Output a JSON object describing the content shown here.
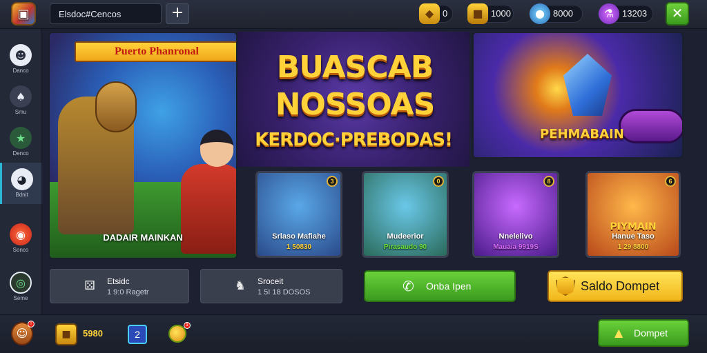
{
  "colors": {
    "accent_green": "#4caf28",
    "accent_yellow": "#ffd23a",
    "background": "#1c2030"
  },
  "header": {
    "search_value": "Elsdoc#Cencos",
    "add_label": "+",
    "close_label": "✕",
    "resources": [
      {
        "icon": "gem-icon",
        "value": "0"
      },
      {
        "icon": "gold-block-icon",
        "value": "1000"
      },
      {
        "icon": "orb-icon",
        "value": "8000"
      },
      {
        "icon": "potion-icon",
        "value": "13203"
      }
    ]
  },
  "sidebar": {
    "items": [
      {
        "icon": "ghost-icon",
        "label": "Danco"
      },
      {
        "icon": "mask-icon",
        "label": "Smu"
      },
      {
        "icon": "star-icon",
        "label": "Denco"
      },
      {
        "icon": "helmet-icon",
        "label": "Bdnit"
      },
      {
        "icon": "record-icon",
        "label": "Sonco"
      },
      {
        "icon": "target-icon",
        "label": "Seme"
      }
    ]
  },
  "hero": {
    "title": "Puerto Phanronal",
    "caption": "DADAIR MAINKAN"
  },
  "banner": {
    "line1": "BUASCAB",
    "line2": "NOSSOAS",
    "line3": "KERDOC·PREBODAS!"
  },
  "promo": {
    "label": "PEHMABAIN"
  },
  "cards": [
    {
      "badge": "3",
      "title": "Srlaso Mafiahe",
      "subtitle": "1 50830",
      "sub_color": "#ffd23a"
    },
    {
      "badge": "0",
      "title": "Mudeerior",
      "subtitle": "Pirasaudo 90",
      "sub_color": "#6ae03a"
    },
    {
      "badge": "8",
      "title": "Nnelelivo",
      "subtitle": "Mauaia 9919S",
      "sub_color": "#d86aff"
    },
    {
      "badge": "6",
      "big": "PIYMAIN",
      "title": "Hanue Taso",
      "subtitle": "1 29 8800",
      "sub_color": "#ffd23a"
    }
  ],
  "info": [
    {
      "icon": "dice-icon",
      "title": "Etsidc",
      "subtitle": "1 9:0 Ragetr"
    },
    {
      "icon": "shield-knight-icon",
      "title": "Sroceit",
      "subtitle": "1 5I 18 DOSOS"
    }
  ],
  "actions": {
    "green_label": "Onba Ipen",
    "yellow_label": "Saldo Dompet"
  },
  "bottom": {
    "avatar_badge": "!",
    "coin_value": "5980",
    "box_label": "2",
    "fruit_badge": "1",
    "dompet_label": "Dompet"
  }
}
